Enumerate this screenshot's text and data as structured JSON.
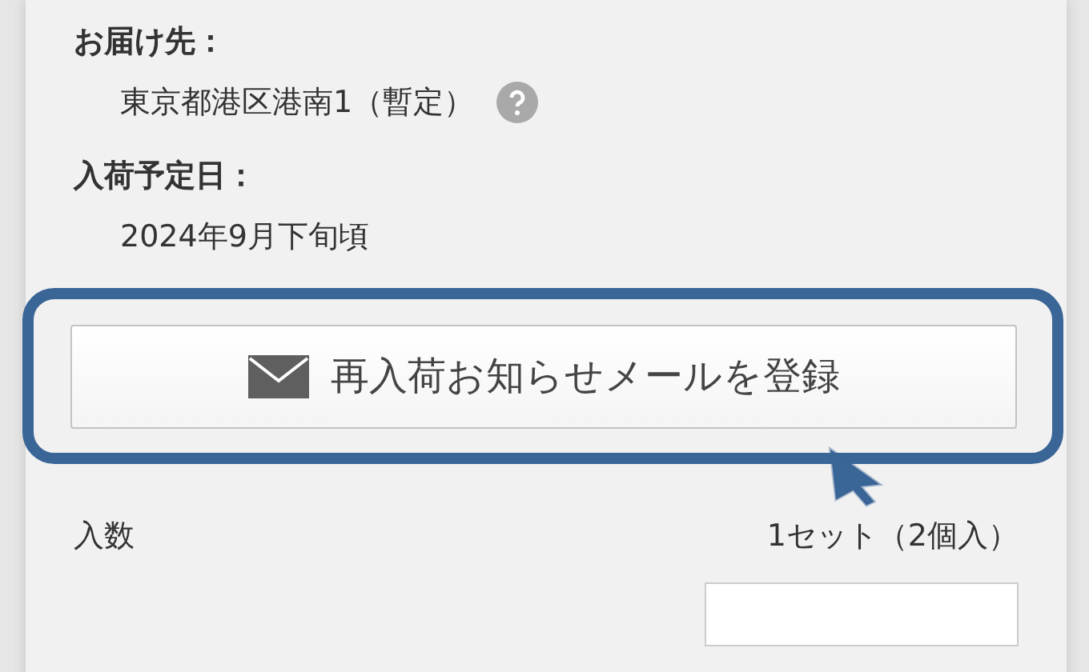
{
  "delivery": {
    "label": "お届け先：",
    "value": "東京都港区港南1（暫定）"
  },
  "arrival": {
    "label": "入荷予定日：",
    "value": "2024年9月下旬頃"
  },
  "notify_button": {
    "label": "再入荷お知らせメールを登録"
  },
  "quantity": {
    "label": "入数",
    "value": "1セット（2個入）"
  }
}
